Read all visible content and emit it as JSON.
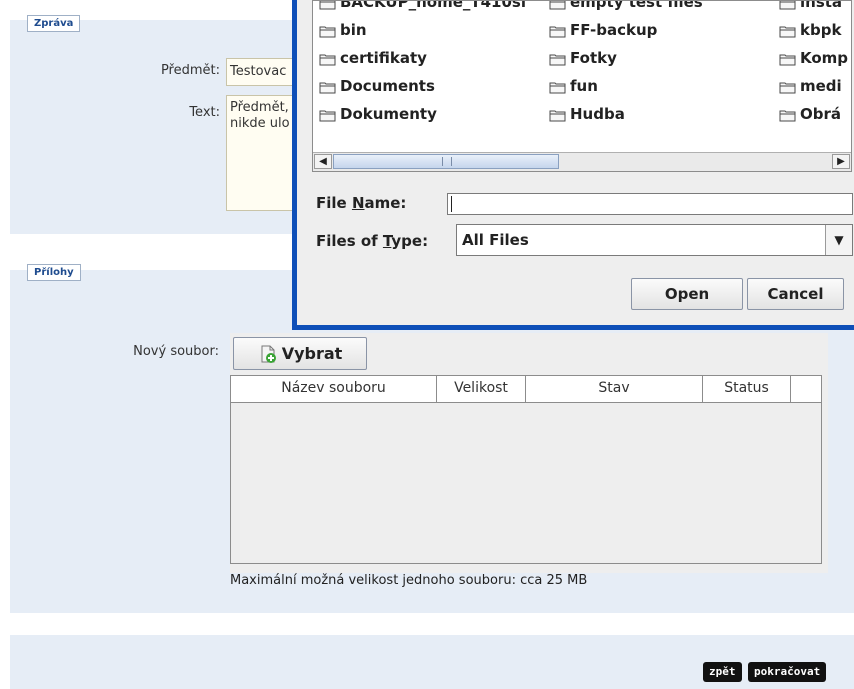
{
  "message_section": {
    "tab_label": "Zpráva",
    "subject_label": "Předmět:",
    "subject_value": "Testovac",
    "text_label": "Text:",
    "text_value": "Předmět,\nnikde ulo"
  },
  "attachments_section": {
    "tab_label": "Přílohy",
    "new_file_label": "Nový soubor:",
    "choose_button": "Vybrat",
    "table_headers": [
      "Název souboru",
      "Velikost",
      "Stav",
      "Status"
    ],
    "max_size_note": "Maximální možná velikost jednoho souboru: cca 25 MB"
  },
  "footer": {
    "back_button": "zpět",
    "continue_button": "pokračovat"
  },
  "file_dialog": {
    "files": [
      "BACKUP_home_T410sl",
      "empty test files",
      "insta",
      "bin",
      "FF-backup",
      "kbpk",
      "certifikaty",
      "Fotky",
      "Komp",
      "Documents",
      "fun",
      "medi",
      "Dokumenty",
      "Hudba",
      "Obrá"
    ],
    "file_name_label_pre": "File ",
    "file_name_label_mnemonic": "N",
    "file_name_label_post": "ame:",
    "file_name_value": "",
    "files_of_type_label_pre": "Files of ",
    "files_of_type_label_mnemonic": "T",
    "files_of_type_label_post": "ype:",
    "files_of_type_value": "All Files",
    "open_button": "Open",
    "cancel_button": "Cancel"
  },
  "colors": {
    "panel_bg": "#e6edf6",
    "dialog_frame": "#0e4fb8",
    "tab_text": "#1f4c8f"
  }
}
